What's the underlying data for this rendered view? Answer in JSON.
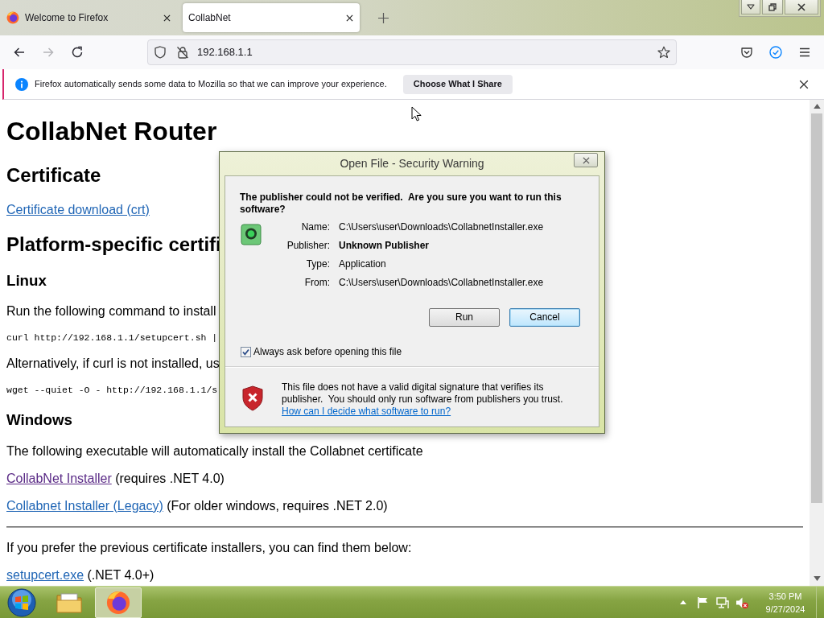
{
  "browser": {
    "tabs": [
      {
        "label": "Welcome to Firefox",
        "kind": "welcome",
        "selected": false
      },
      {
        "label": "CollabNet",
        "kind": "site",
        "selected": true
      }
    ],
    "navigation": [
      {
        "kind": "back",
        "disabled": false
      },
      {
        "kind": "forward",
        "disabled": true
      },
      {
        "kind": "reload",
        "disabled": false
      }
    ],
    "address": "192.168.1.1",
    "notification": {
      "message": "Firefox automatically sends some data to Mozilla so that we can improve your experience.",
      "button": "Choose What I Share"
    }
  },
  "page": {
    "blocks": [
      {
        "kind": "h1",
        "text": "CollabNet Router"
      },
      {
        "kind": "h2",
        "text": "Certificate"
      },
      {
        "kind": "para",
        "parts": [
          {
            "kind": "link",
            "text": "Certificate download (crt)",
            "visited": false
          }
        ]
      },
      {
        "kind": "h2",
        "text": "Platform-specific certifi"
      },
      {
        "kind": "h3",
        "text": "Linux"
      },
      {
        "kind": "para",
        "parts": [
          {
            "kind": "text",
            "text": "Run the following command to install"
          }
        ]
      },
      {
        "kind": "code",
        "text": "curl http://192.168.1.1/setupcert.sh |"
      },
      {
        "kind": "para",
        "parts": [
          {
            "kind": "text",
            "text": "Alternatively, if curl is not installed, us"
          }
        ]
      },
      {
        "kind": "code",
        "text": "wget --quiet -O - http://192.168.1.1/s"
      },
      {
        "kind": "h3",
        "text": "Windows"
      },
      {
        "kind": "para",
        "parts": [
          {
            "kind": "text",
            "text": "The following executable will automatically install the Collabnet certificate"
          }
        ]
      },
      {
        "kind": "para",
        "parts": [
          {
            "kind": "link",
            "text": "CollabNet Installer",
            "visited": true
          },
          {
            "kind": "text",
            "text": "(requires .NET 4.0)"
          }
        ]
      },
      {
        "kind": "para",
        "parts": [
          {
            "kind": "link",
            "text": "Collabnet Installer (Legacy)",
            "visited": false
          },
          {
            "kind": "text",
            "text": "(For older windows, requires .NET 2.0)"
          }
        ]
      },
      {
        "kind": "rule"
      },
      {
        "kind": "para",
        "parts": [
          {
            "kind": "text",
            "text": "If you prefer the previous certificate installers, you can find them below:"
          }
        ]
      },
      {
        "kind": "para",
        "parts": [
          {
            "kind": "link",
            "text": "setupcert.exe",
            "visited": false
          },
          {
            "kind": "text",
            "text": "(.NET 4.0+)"
          }
        ]
      }
    ]
  },
  "dialog": {
    "title": "Open File - Security Warning",
    "question": "The publisher could not be verified.  Are you sure you want to run this software?",
    "fields": [
      {
        "label": "Name:",
        "value": "C:\\Users\\user\\Downloads\\CollabnetInstaller.exe",
        "bold": false
      },
      {
        "label": "Publisher:",
        "value": "Unknown Publisher",
        "bold": true
      },
      {
        "label": "Type:",
        "value": "Application",
        "bold": false
      },
      {
        "label": "From:",
        "value": "C:\\Users\\user\\Downloads\\CollabnetInstaller.exe",
        "bold": false
      }
    ],
    "buttons": [
      {
        "label": "Run",
        "focused": false
      },
      {
        "label": "Cancel",
        "focused": true
      }
    ],
    "checkbox": {
      "label": "Always ask before opening this file",
      "checked": true
    },
    "warning": "This file does not have a valid digital signature that verifies its publisher.  You should only run software from publishers you trust.",
    "help_link": "How can I decide what software to run?"
  },
  "taskbar": {
    "apps": [
      {
        "kind": "explorer",
        "active": false
      },
      {
        "kind": "firefox",
        "active": true
      }
    ],
    "volume_muted": true,
    "clock": {
      "time": "3:50 PM",
      "date": "9/27/2024"
    }
  }
}
